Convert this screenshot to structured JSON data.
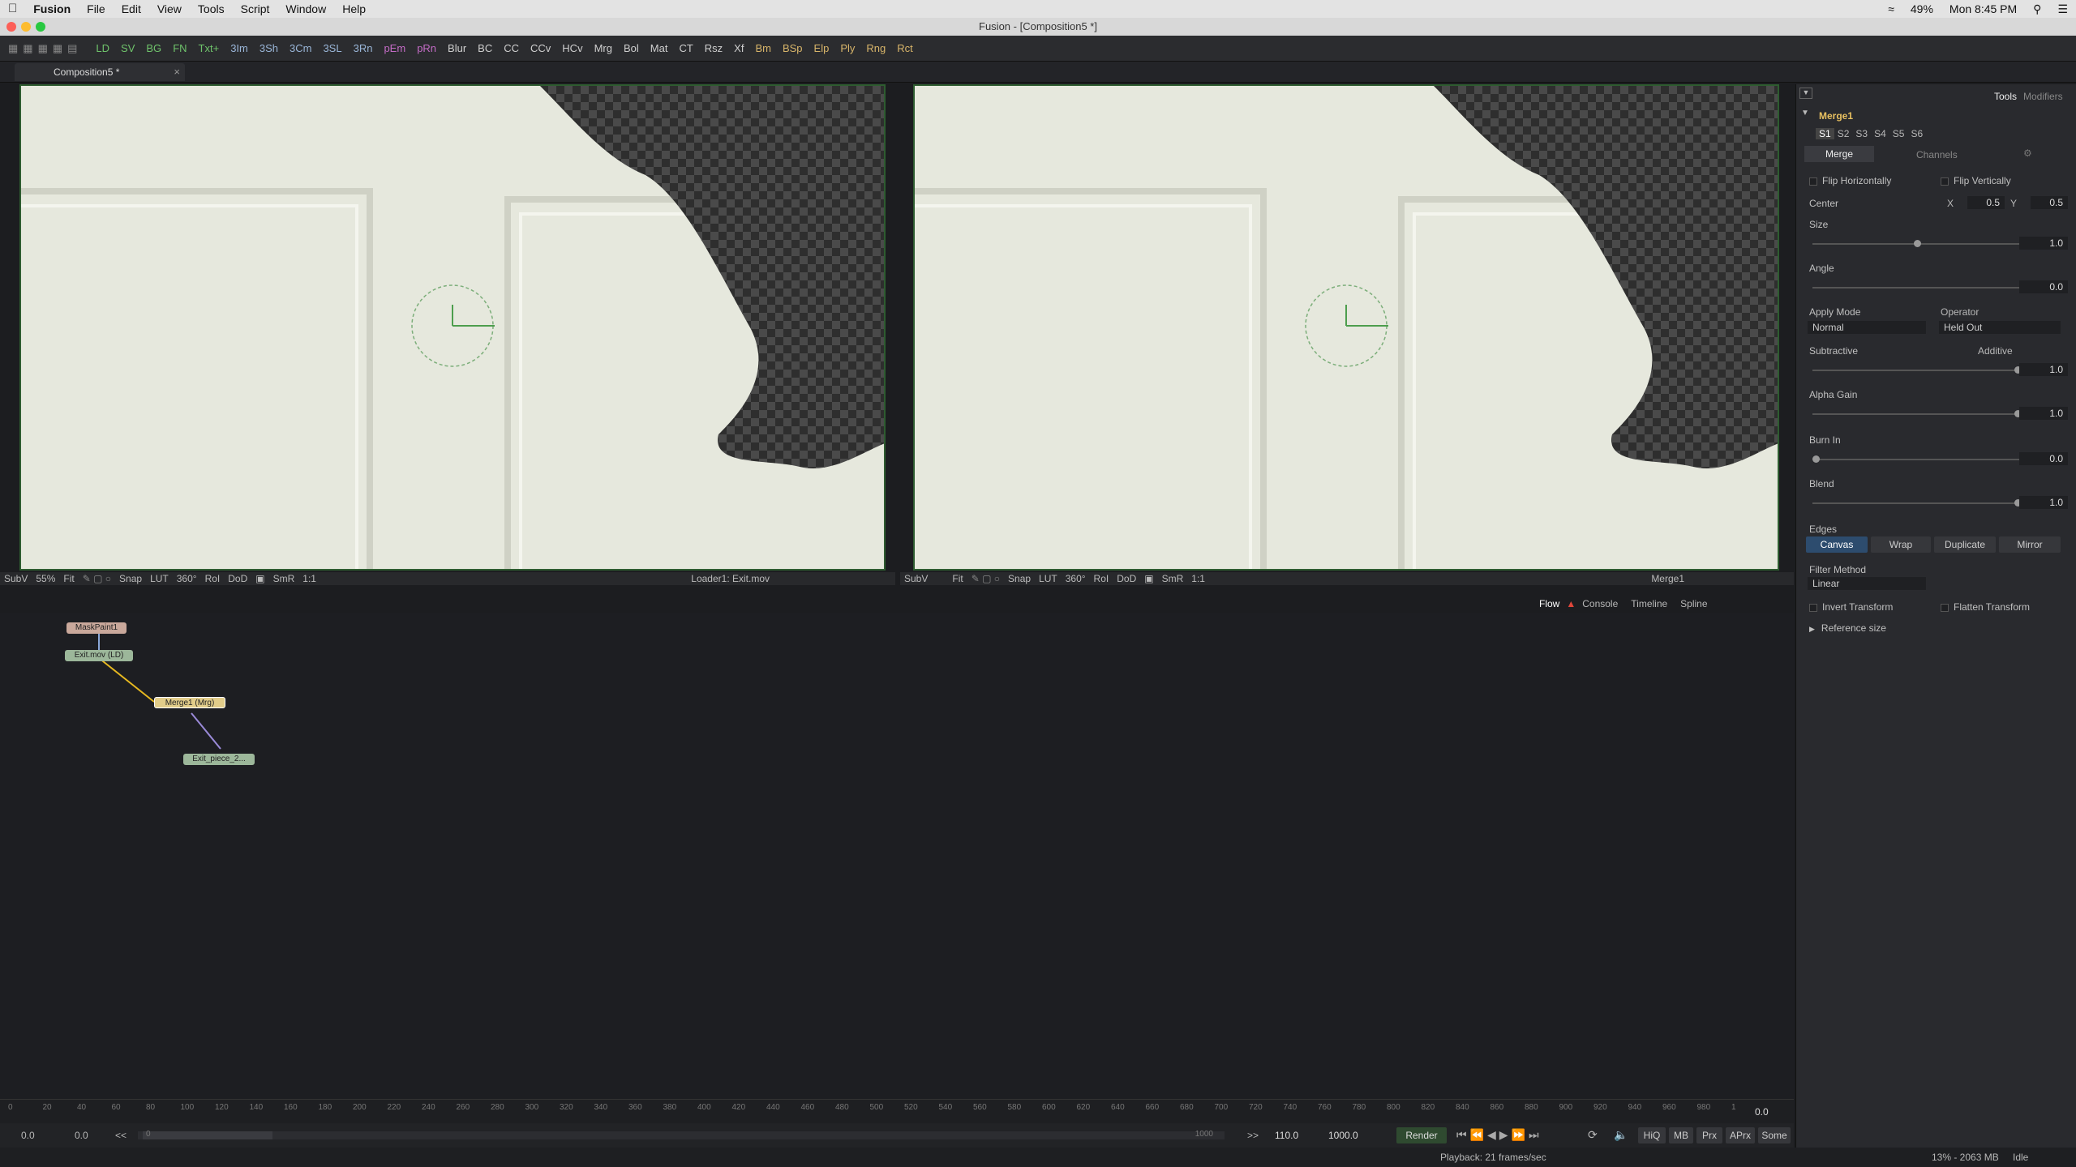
{
  "menubar": {
    "app": "Fusion",
    "items": [
      "File",
      "Edit",
      "View",
      "Tools",
      "Script",
      "Window",
      "Help"
    ],
    "battery": "49%",
    "clock": "Mon 8:45 PM"
  },
  "window": {
    "title": "Fusion - [Composition5 *]"
  },
  "toolbar": {
    "buttons": [
      "LD",
      "SV",
      "BG",
      "FN",
      "Txt+",
      "3Im",
      "3Sh",
      "3Cm",
      "3SL",
      "3Rn",
      "pEm",
      "pRn",
      "Blur",
      "BC",
      "CC",
      "CCv",
      "HCv",
      "Mrg",
      "Bol",
      "Mat",
      "CT",
      "Rsz",
      "Xf",
      "Bm",
      "BSp",
      "Elp",
      "Ply",
      "Rng",
      "Rct"
    ],
    "colors": [
      "#6fc36b",
      "#6fc36b",
      "#6fc36b",
      "#6fc36b",
      "#6fc36b",
      "#9ab6d8",
      "#9ab6d8",
      "#9ab6d8",
      "#9ab6d8",
      "#9ab6d8",
      "#c46cc6",
      "#c46cc6",
      "#cfcfcf",
      "#cfcfcf",
      "#cfcfcf",
      "#cfcfcf",
      "#cfcfcf",
      "#cfcfcf",
      "#cfcfcf",
      "#cfcfcf",
      "#cfcfcf",
      "#cfcfcf",
      "#cfcfcf",
      "#d8b56a",
      "#d8b56a",
      "#d8b56a",
      "#d8b56a",
      "#d8b56a",
      "#d8b56a"
    ]
  },
  "tab": {
    "label": "Composition5 *",
    "close": "×"
  },
  "viewer1": {
    "subv": "SubV",
    "zoom": "55%",
    "fit": "Fit",
    "snap": "Snap",
    "lut": "LUT",
    "angle": "360°",
    "roi": "RoI",
    "dod": "DoD",
    "smr": "SmR",
    "ratio": "1:1",
    "label": "Loader1: Exit.mov"
  },
  "viewer2": {
    "subv": "SubV",
    "fit": "Fit",
    "snap": "Snap",
    "lut": "LUT",
    "angle": "360°",
    "roi": "RoI",
    "dod": "DoD",
    "smr": "SmR",
    "ratio": "1:1",
    "label": "Merge1"
  },
  "flowtabs": {
    "flow": "Flow",
    "console": "Console",
    "timeline": "Timeline",
    "spline": "Spline"
  },
  "nodes": {
    "mask": "MaskPaint1",
    "loader": "Exit.mov (LD)",
    "merge": "Merge1 (Mrg)",
    "saver": "Exit_piece_2..."
  },
  "ruler": {
    "ticks": [
      "0",
      "20",
      "40",
      "60",
      "80",
      "100",
      "120",
      "140",
      "160",
      "180",
      "200",
      "220",
      "240",
      "260",
      "280",
      "300",
      "320",
      "340",
      "360",
      "380",
      "400",
      "420",
      "440",
      "460",
      "480",
      "500",
      "520",
      "540",
      "560",
      "580",
      "600",
      "620",
      "640",
      "660",
      "680",
      "700",
      "720",
      "740",
      "760",
      "780",
      "800",
      "820",
      "840",
      "860",
      "880",
      "900",
      "920",
      "940",
      "960",
      "980",
      "1"
    ],
    "current": "0.0"
  },
  "transport": {
    "start": "0.0",
    "render_start": "0.0",
    "back": "<<",
    "range_start": "0",
    "range_end": "1000",
    "fwd": ">>",
    "render_end": "110.0",
    "end": "1000.0",
    "render": "Render",
    "hiq": "HiQ",
    "mb": "MB",
    "prx": "Prx",
    "aprx": "APrx",
    "some": "Some"
  },
  "status": {
    "playback": "Playback: 21 frames/sec",
    "memory": "13% - 2063 MB",
    "state": "Idle"
  },
  "inspector": {
    "tabs": [
      "Tools",
      "Modifiers"
    ],
    "node": "Merge1",
    "slots": [
      "S1",
      "S2",
      "S3",
      "S4",
      "S5",
      "S6"
    ],
    "subtabs": [
      "Merge",
      "Channels"
    ],
    "flip_h": "Flip Horizontally",
    "flip_v": "Flip Vertically",
    "center": "Center",
    "cx_label": "X",
    "cx": "0.5",
    "cy_label": "Y",
    "cy": "0.5",
    "size": "Size",
    "size_val": "1.0",
    "angle": "Angle",
    "angle_val": "0.0",
    "apply_mode": "Apply Mode",
    "apply_val": "Normal",
    "operator": "Operator",
    "operator_val": "Held Out",
    "subtractive": "Subtractive",
    "additive": "Additive",
    "sub_val": "1.0",
    "alpha_gain": "Alpha Gain",
    "alpha_val": "1.0",
    "burn_in": "Burn In",
    "burn_val": "0.0",
    "blend": "Blend",
    "blend_val": "1.0",
    "edges": "Edges",
    "edge_buttons": [
      "Canvas",
      "Wrap",
      "Duplicate",
      "Mirror"
    ],
    "filter": "Filter Method",
    "filter_val": "Linear",
    "invert": "Invert Transform",
    "flatten": "Flatten Transform",
    "refsize": "Reference size"
  },
  "levels": {
    "size": 0.5,
    "angle": 0.5,
    "subtractive": 1.0,
    "alpha": 1.0,
    "burn": 0.0,
    "blend": 1.0
  }
}
